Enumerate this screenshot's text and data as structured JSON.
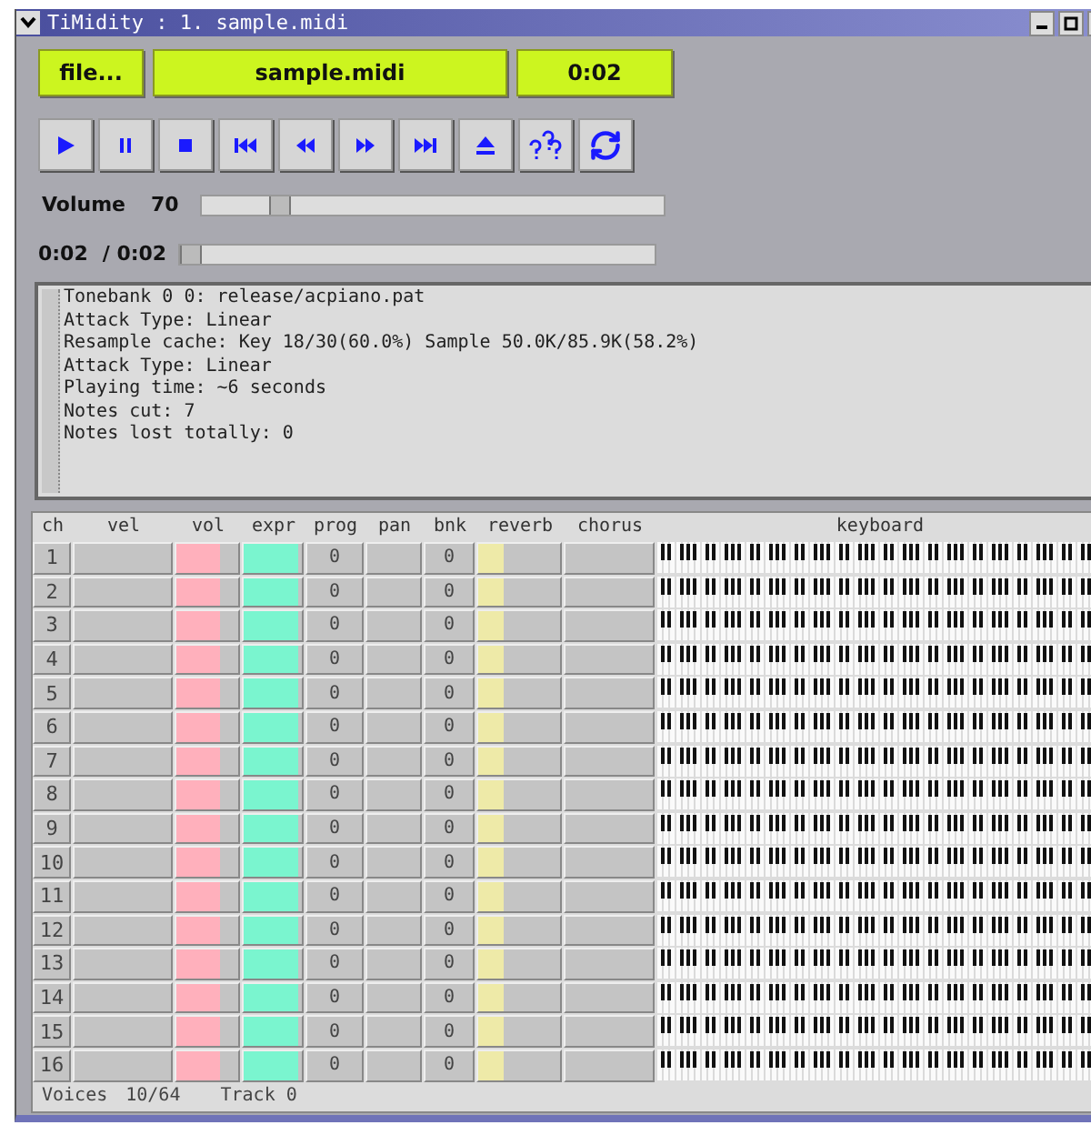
{
  "window": {
    "title": "TiMidity : 1. sample.midi"
  },
  "top": {
    "file_button": "file...",
    "filename": "sample.midi",
    "time": "0:02"
  },
  "transport": [
    {
      "kind": "play"
    },
    {
      "kind": "pause"
    },
    {
      "kind": "stop"
    },
    {
      "kind": "first"
    },
    {
      "kind": "rewind"
    },
    {
      "kind": "forward"
    },
    {
      "kind": "last"
    },
    {
      "kind": "eject"
    },
    {
      "kind": "help"
    },
    {
      "kind": "repeat"
    }
  ],
  "volume": {
    "label": "Volume",
    "value": "70",
    "level": 0.15
  },
  "position": {
    "current": "0:02",
    "total": "/ 0:02",
    "level": 0
  },
  "log": [
    "Tonebank 0 0: release/acpiano.pat",
    "Attack Type: Linear",
    "Resample cache: Key 18/30(60.0%) Sample 50.0K/85.9K(58.2%)",
    "Attack Type: Linear",
    "Playing time: ~6 seconds",
    "Notes cut: 7",
    "Notes lost totally: 0"
  ],
  "table": {
    "columns": [
      "ch",
      "vel",
      "vol",
      "expr",
      "prog",
      "pan",
      "bnk",
      "reverb",
      "chorus",
      "keyboard"
    ],
    "rows": [
      {
        "ch": "1",
        "vol": {
          "level": 0.7
        },
        "expr": {
          "level": 0.95
        },
        "prog": "0",
        "bnk": "0",
        "reverb": {
          "level": 0.3
        }
      },
      {
        "ch": "2",
        "vol": {
          "level": 0.7
        },
        "expr": {
          "level": 0.95
        },
        "prog": "0",
        "bnk": "0",
        "reverb": {
          "level": 0.3
        }
      },
      {
        "ch": "3",
        "vol": {
          "level": 0.7
        },
        "expr": {
          "level": 0.95
        },
        "prog": "0",
        "bnk": "0",
        "reverb": {
          "level": 0.3
        }
      },
      {
        "ch": "4",
        "vol": {
          "level": 0.7
        },
        "expr": {
          "level": 0.95
        },
        "prog": "0",
        "bnk": "0",
        "reverb": {
          "level": 0.3
        }
      },
      {
        "ch": "5",
        "vol": {
          "level": 0.7
        },
        "expr": {
          "level": 0.95
        },
        "prog": "0",
        "bnk": "0",
        "reverb": {
          "level": 0.3
        }
      },
      {
        "ch": "6",
        "vol": {
          "level": 0.7
        },
        "expr": {
          "level": 0.95
        },
        "prog": "0",
        "bnk": "0",
        "reverb": {
          "level": 0.3
        }
      },
      {
        "ch": "7",
        "vol": {
          "level": 0.7
        },
        "expr": {
          "level": 0.95
        },
        "prog": "0",
        "bnk": "0",
        "reverb": {
          "level": 0.3
        }
      },
      {
        "ch": "8",
        "vol": {
          "level": 0.7
        },
        "expr": {
          "level": 0.95
        },
        "prog": "0",
        "bnk": "0",
        "reverb": {
          "level": 0.3
        }
      },
      {
        "ch": "9",
        "vol": {
          "level": 0.7
        },
        "expr": {
          "level": 0.95
        },
        "prog": "0",
        "bnk": "0",
        "reverb": {
          "level": 0.3
        }
      },
      {
        "ch": "10",
        "vol": {
          "level": 0.7
        },
        "expr": {
          "level": 0.95
        },
        "prog": "0",
        "bnk": "0",
        "reverb": {
          "level": 0.3
        }
      },
      {
        "ch": "11",
        "vol": {
          "level": 0.7
        },
        "expr": {
          "level": 0.95
        },
        "prog": "0",
        "bnk": "0",
        "reverb": {
          "level": 0.3
        }
      },
      {
        "ch": "12",
        "vol": {
          "level": 0.7
        },
        "expr": {
          "level": 0.95
        },
        "prog": "0",
        "bnk": "0",
        "reverb": {
          "level": 0.3
        }
      },
      {
        "ch": "13",
        "vol": {
          "level": 0.7
        },
        "expr": {
          "level": 0.95
        },
        "prog": "0",
        "bnk": "0",
        "reverb": {
          "level": 0.3
        }
      },
      {
        "ch": "14",
        "vol": {
          "level": 0.7
        },
        "expr": {
          "level": 0.95
        },
        "prog": "0",
        "bnk": "0",
        "reverb": {
          "level": 0.3
        }
      },
      {
        "ch": "15",
        "vol": {
          "level": 0.7
        },
        "expr": {
          "level": 0.95
        },
        "prog": "0",
        "bnk": "0",
        "reverb": {
          "level": 0.3
        }
      },
      {
        "ch": "16",
        "vol": {
          "level": 0.7
        },
        "expr": {
          "level": 0.95
        },
        "prog": "0",
        "bnk": "0",
        "reverb": {
          "level": 0.3
        }
      }
    ]
  },
  "status": {
    "voices_label": "Voices",
    "voices": "10/64",
    "track": "Track 0"
  }
}
